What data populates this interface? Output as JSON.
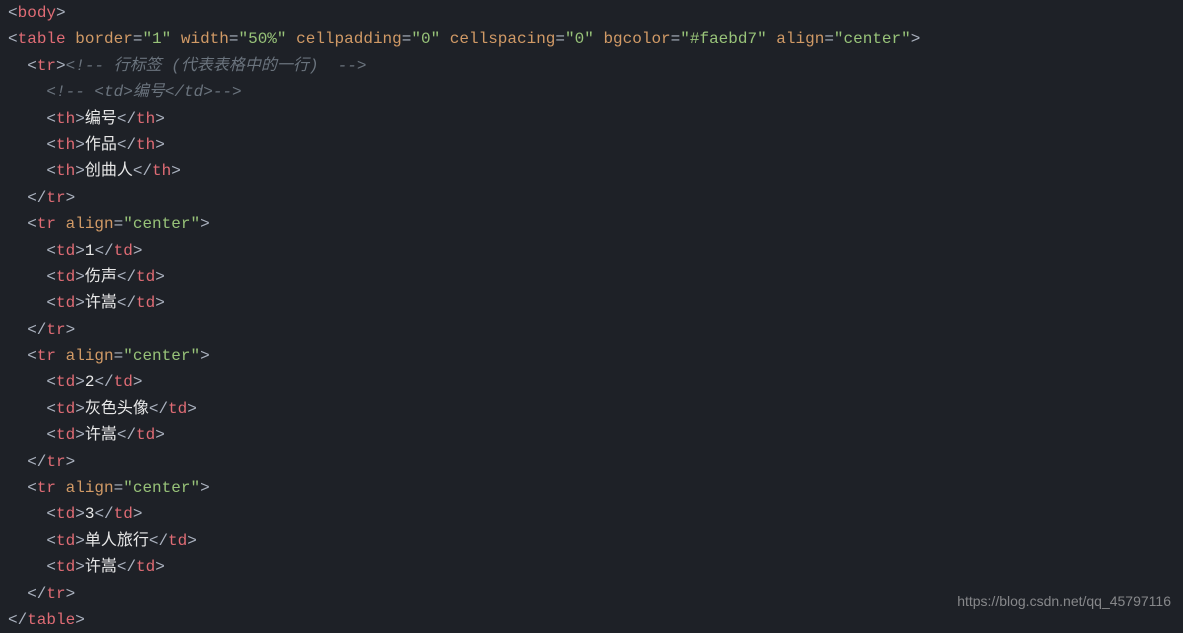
{
  "code": {
    "t_body": "body",
    "t_table": "table",
    "t_tr": "tr",
    "t_th": "th",
    "t_td": "td",
    "a_border_n": "border",
    "a_border_v": "\"1\"",
    "a_width_n": "width",
    "a_width_v": "\"50%\"",
    "a_cellp_n": "cellpadding",
    "a_cellp_v": "\"0\"",
    "a_cells_n": "cellspacing",
    "a_cells_v": "\"0\"",
    "a_bg_n": "bgcolor",
    "a_bg_v": "\"#faebd7\"",
    "a_align_n": "align",
    "a_align_v": "\"center\"",
    "cmt_row": "<!-- 行标签 (代表表格中的一行)  -->",
    "cmt_td": "<!-- <td>编号</td>-->",
    "th1": "编号",
    "th2": "作品",
    "th3": "创曲人",
    "rows": [
      {
        "c1": "1",
        "c2": "伤声",
        "c3": "许嵩"
      },
      {
        "c1": "2",
        "c2": "灰色头像",
        "c3": "许嵩"
      },
      {
        "c1": "3",
        "c2": "单人旅行",
        "c3": "许嵩"
      }
    ]
  },
  "watermark": "https://blog.csdn.net/qq_45797116"
}
